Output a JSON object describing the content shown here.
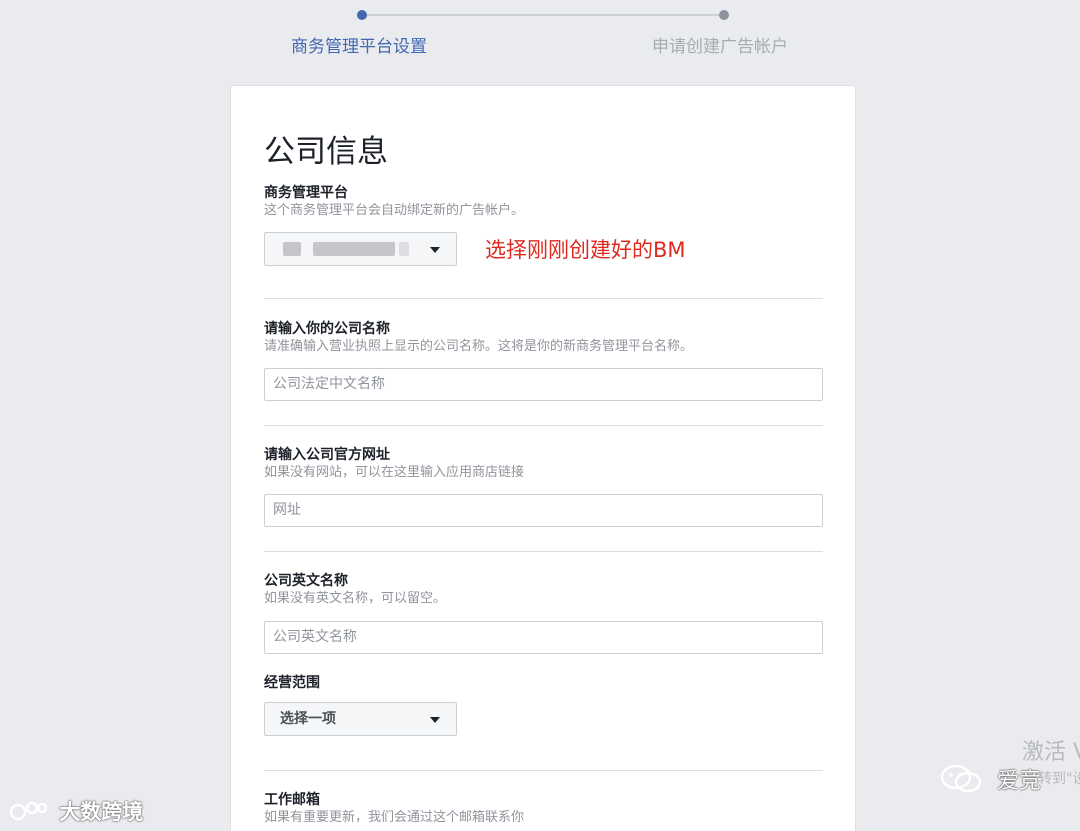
{
  "stepper": {
    "steps": [
      {
        "label": "商务管理平台设置",
        "state": "active"
      },
      {
        "label": "申请创建广告帐户",
        "state": "inactive"
      }
    ]
  },
  "card": {
    "title": "公司信息",
    "business_manager": {
      "label": "商务管理平台",
      "description": "这个商务管理平台会自动绑定新的广告帐户。",
      "selected_value": ""
    },
    "annotation": "选择刚刚创建好的BM",
    "company_name": {
      "label": "请输入你的公司名称",
      "description": "请准确输入营业执照上显示的公司名称。这将是你的新商务管理平台名称。",
      "placeholder": "公司法定中文名称"
    },
    "website": {
      "label": "请输入公司官方网址",
      "description": "如果没有网站，可以在这里输入应用商店链接",
      "placeholder": "网址"
    },
    "english_name": {
      "label": "公司英文名称",
      "description": "如果没有英文名称，可以留空。",
      "placeholder": "公司英文名称"
    },
    "business_scope": {
      "label": "经营范围",
      "selected_value": "选择一项"
    },
    "work_email": {
      "label": "工作邮箱",
      "description": "如果有重要更新，我们会通过这个邮箱联系你"
    }
  },
  "watermarks": {
    "left_text": "大数跨境",
    "right_text": "爱竞",
    "activate_text": "激活 V",
    "activate_sub": "转到\"设"
  },
  "colors": {
    "accent": "#4267b2",
    "annotation": "#e02a20"
  }
}
